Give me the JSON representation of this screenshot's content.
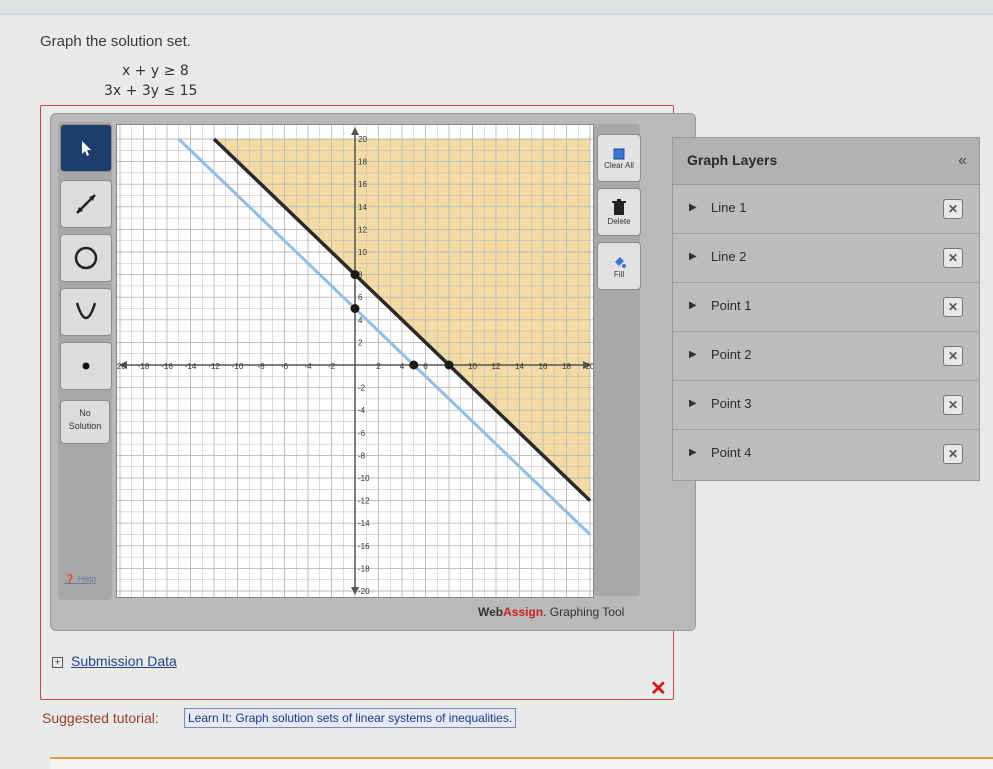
{
  "question": {
    "prompt": "Graph the solution set.",
    "inequality_1": "x + y ≥ 8",
    "inequality_2": "3x + 3y ≤ 15"
  },
  "toolbar": {
    "tools": [
      "pointer-icon",
      "line-icon",
      "circle-icon",
      "parabola-icon",
      "point-icon"
    ],
    "no_solution_line1": "No",
    "no_solution_line2": "Solution",
    "help_label": "Help"
  },
  "graph": {
    "x_min": -20,
    "x_max": 20,
    "y_min": -20,
    "y_max": 20,
    "grid": true,
    "x_tick_labels": [
      "-20",
      "-18",
      "-16",
      "-14",
      "-12",
      "-10",
      "-8",
      "-6",
      "-4",
      "-2",
      "2",
      "4",
      "6",
      "8",
      "10",
      "12",
      "14",
      "16",
      "18",
      "20"
    ],
    "y_tick_labels": [
      "20",
      "18",
      "16",
      "14",
      "12",
      "10",
      "8",
      "6",
      "4",
      "2",
      "-2",
      "-4",
      "-6",
      "-8",
      "-10",
      "-12",
      "-14",
      "-16",
      "-18",
      "-20"
    ],
    "lines": [
      {
        "name": "Line 1",
        "equation": "x + y = 8",
        "color": "#2a2a2a",
        "points": [
          [
            0,
            8
          ],
          [
            8,
            0
          ]
        ]
      },
      {
        "name": "Line 2",
        "equation": "3x + 3y = 15",
        "color": "#8fbfe6",
        "points": [
          [
            0,
            5
          ],
          [
            5,
            0
          ]
        ]
      }
    ],
    "points": [
      [
        0,
        8
      ],
      [
        8,
        0
      ],
      [
        0,
        5
      ],
      [
        5,
        0
      ]
    ],
    "shade_color": "#f3d79a"
  },
  "right_toolbar": {
    "clear_all": "Clear All",
    "delete": "Delete",
    "fill": "Fill"
  },
  "branding": {
    "web": "Web",
    "assign": "Assign",
    "rest": ". Graphing Tool"
  },
  "layers_panel": {
    "title": "Graph Layers",
    "collapse": "«",
    "items": [
      {
        "label": "Line 1"
      },
      {
        "label": "Line 2"
      },
      {
        "label": "Point 1"
      },
      {
        "label": "Point 2"
      },
      {
        "label": "Point 3"
      },
      {
        "label": "Point 4"
      }
    ]
  },
  "submission": {
    "label": "Submission Data",
    "toggle": "+"
  },
  "status": {
    "incorrect_mark": "✕"
  },
  "tutorial": {
    "label": "Suggested tutorial:",
    "link": "Learn It: Graph solution sets of linear systems of inequalities."
  }
}
